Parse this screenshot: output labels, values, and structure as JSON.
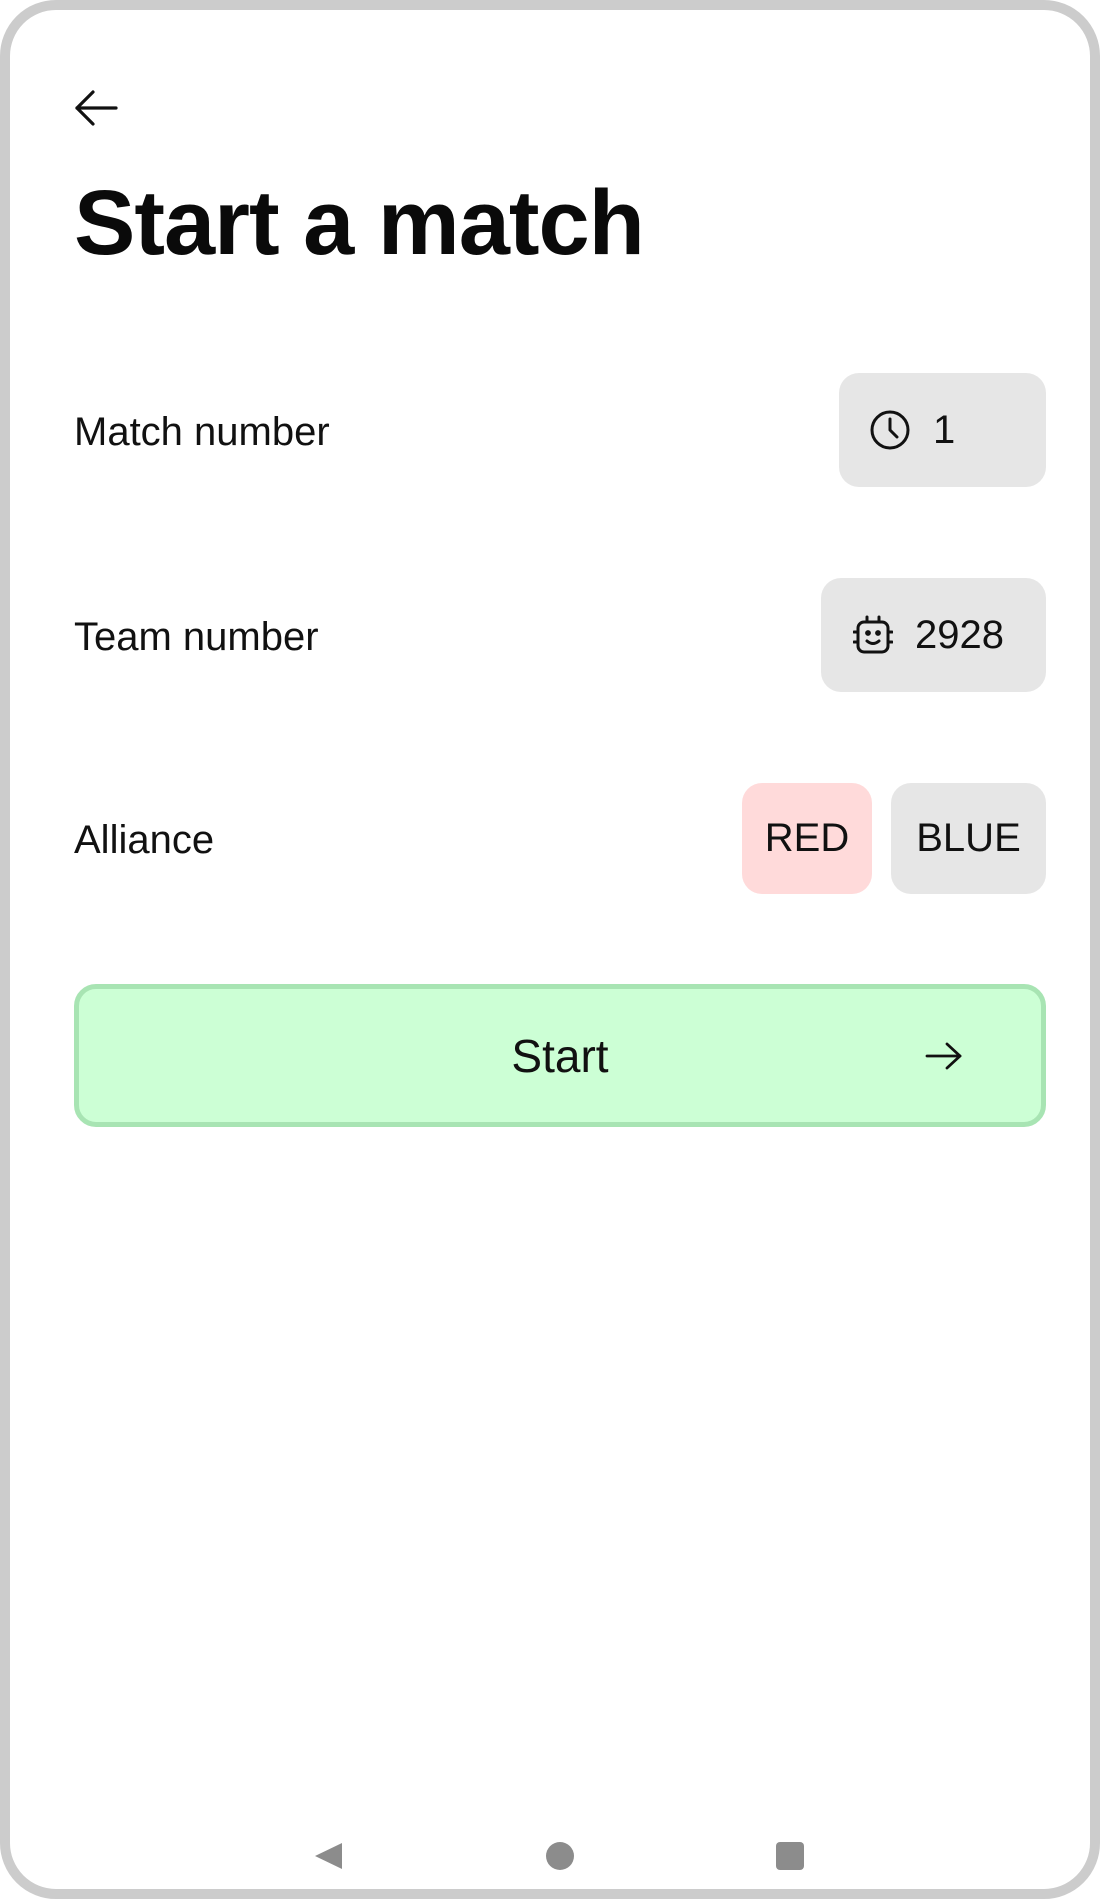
{
  "header": {
    "back_icon": "arrow-left-icon",
    "title": "Start a match"
  },
  "form": {
    "match": {
      "label": "Match number",
      "icon": "clock-icon",
      "value": "1"
    },
    "team": {
      "label": "Team number",
      "icon": "robot-icon",
      "value": "2928"
    },
    "alliance": {
      "label": "Alliance",
      "options": [
        "RED",
        "BLUE"
      ],
      "selected": "RED"
    },
    "start": {
      "label": "Start",
      "icon": "arrow-right-icon"
    }
  },
  "colors": {
    "red_selected": "#ffdada",
    "chip_bg": "#e6e6e6",
    "start_bg": "#ccffd5",
    "start_border": "#a8e4b3"
  },
  "system_nav": {
    "icons": [
      "nav-back-icon",
      "nav-home-icon",
      "nav-recents-icon"
    ]
  }
}
